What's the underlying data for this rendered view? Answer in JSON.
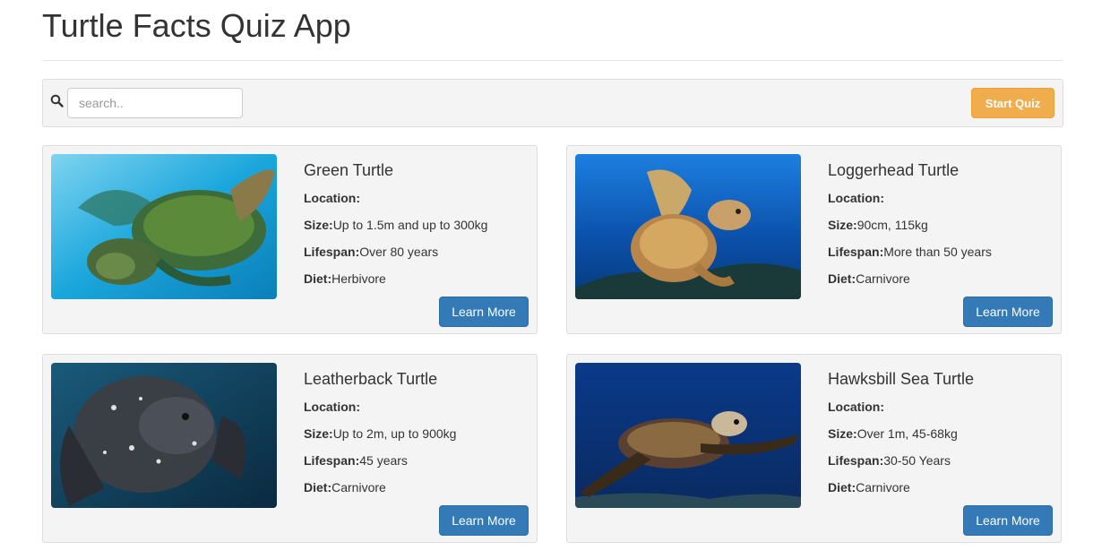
{
  "header": {
    "title": "Turtle Facts Quiz App"
  },
  "toolbar": {
    "search_placeholder": "search..",
    "search_value": "",
    "start_label": "Start Quiz"
  },
  "labels": {
    "location": "Location:",
    "size": "Size:",
    "lifespan": "Lifespan:",
    "diet": "Diet:"
  },
  "cards": [
    {
      "name": "Green Turtle",
      "location": "",
      "size": "Up to 1.5m and up to 300kg",
      "lifespan": "Over 80 years",
      "diet": "Herbivore",
      "button": "Learn More"
    },
    {
      "name": "Loggerhead Turtle",
      "location": "",
      "size": "90cm, 115kg",
      "lifespan": "More than 50 years",
      "diet": "Carnivore",
      "button": "Learn More"
    },
    {
      "name": "Leatherback Turtle",
      "location": "",
      "size": "Up to 2m, up to 900kg",
      "lifespan": "45 years",
      "diet": "Carnivore",
      "button": "Learn More"
    },
    {
      "name": "Hawksbill Sea Turtle",
      "location": "",
      "size": "Over 1m, 45-68kg",
      "lifespan": "30-50 Years",
      "diet": "Carnivore",
      "button": "Learn More"
    }
  ],
  "colors": {
    "primary": "#337ab7",
    "warning": "#f0ad4e",
    "panel": "#f4f4f4",
    "border": "#dddddd"
  },
  "icons": {
    "search": "search-icon"
  }
}
